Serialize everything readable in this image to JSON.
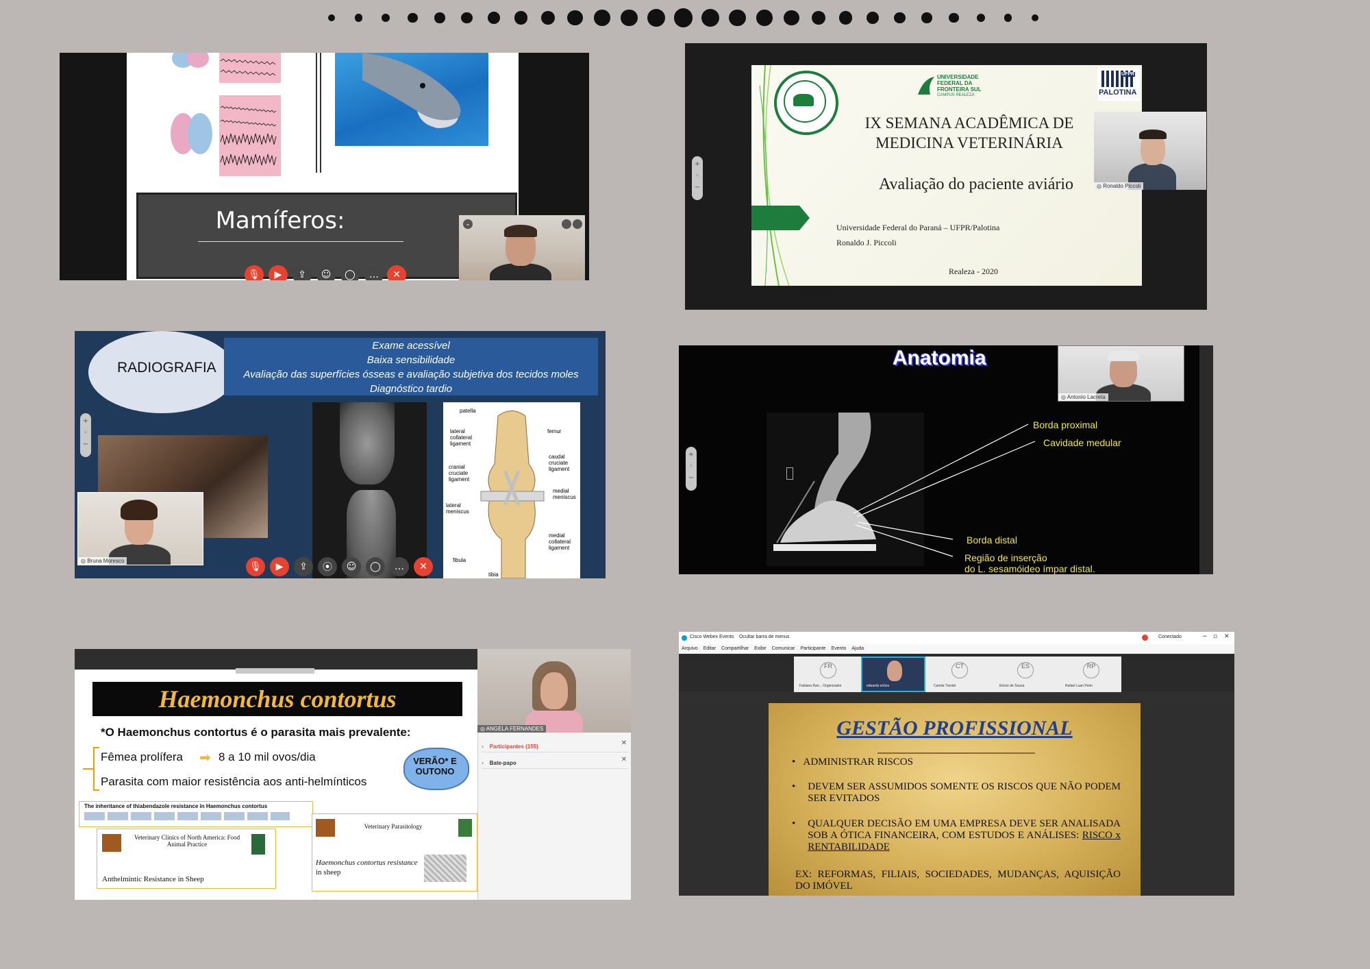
{
  "colors": {
    "background": "#bcb6b5",
    "webex_red": "#e5432f",
    "ufps_green": "#1e7d3c",
    "radio_blue": "#203a5c",
    "radio_band": "#2a5a9a",
    "haemonchus_title": "#f3b73a",
    "bubble_blue": "#7fb2e8",
    "gestao_gold": "#c9a24a",
    "gestao_title": "#1f3f8f",
    "xray_label": "#f0e84a"
  },
  "panel1": {
    "title": "Mamíferos:",
    "controls": [
      "mic-icon",
      "camera-icon",
      "share-icon",
      "participants-icon",
      "chat-icon",
      "more-icon",
      "end-call-icon"
    ]
  },
  "panel2": {
    "univ_lines": [
      "UNIVERSIDADE",
      "FEDERAL DA",
      "FRONTEIRA SUL",
      "CAMPUS REALEZA"
    ],
    "palotina": "PALOTINA",
    "ufpr": "UFPR",
    "title_line1": "IX SEMANA ACADÊMICA DE",
    "title_line2": "MEDICINA VETERINÁRIA",
    "subtitle": "Avaliação do paciente aviário",
    "institution": "Universidade Federal do Paraná – UFPR/Palotina",
    "author": "Ronaldo J. Piccoli",
    "place_year": "Realeza - 2020",
    "participant_name": "Ronaldo Piccoli"
  },
  "panel3": {
    "title": "RADIOGRAFIA",
    "bullets": [
      "Exame acessível",
      "Baixa sensibilidade",
      "Avaliação das superfícies ósseas e avaliação subjetiva dos tecidos moles",
      "Diagnóstico tardio"
    ],
    "participant_name": "Bruna Moresco",
    "anatomy_labels": {
      "patella": "patella",
      "femur": "femur",
      "lateral_collateral": "lateral\ncollateral\nligament",
      "caudal_cruciate": "caudal\ncruciate\nligament",
      "cranial_cruciate": "cranial\ncruciate\nligament",
      "medial_meniscus": "medial\nmeniscus",
      "lateral_meniscus": "lateral\nmeniscus",
      "medial_collateral": "medial\ncollateral\nligament",
      "fibula": "fibula",
      "tibia": "tibia"
    }
  },
  "panel4": {
    "title": "Anatomia",
    "labels": [
      "Borda proximal",
      "Cavidade medular",
      "Borda distal",
      "Região de inserção",
      "do L. sesamóideo ímpar distal."
    ],
    "participant_name": "Antonio Lacreta"
  },
  "panel5": {
    "title": "Haemonchus contortus",
    "lead": "*O Haemonchus contortus é o parasita mais prevalente:",
    "bullet1_a": "Fêmea prolífera",
    "bullet1_b": "8 a 10 mil ovos/dia",
    "bullet2": "Parasita com maior resistência aos anti-helmínticos",
    "bubble": "VERÃO* E\nOUTONO",
    "paper1_title": "The inheritance of thiabendazole resistance in Haemonchus contortus",
    "paper2_journal": "Veterinary Clinics of North America: Food Animal Practice",
    "paper2_title": "Anthelmintic Resistance in Sheep",
    "paper3_journal": "Veterinary Parasitology",
    "paper3_title": "Haemonchus contortus resistance",
    "paper3_title2": "in sheep",
    "participant_name": "ANGELA FERNANDES",
    "participants_label": "Participantes (155)",
    "chat_label": "Bate-papo"
  },
  "panel6": {
    "window_title": "Cisco Webex Events",
    "hide_menu": "Ocultar barra de menus",
    "status": "Conectado",
    "menu": [
      "Arquivo",
      "Editar",
      "Compartilhar",
      "Exibir",
      "Comunicar",
      "Participante",
      "Evento",
      "Ajuda"
    ],
    "participants": [
      {
        "initials": "FR",
        "name": "Fabiana Ran... Organizador"
      },
      {
        "initials": "",
        "name": "eduardo echos"
      },
      {
        "initials": "CT",
        "name": "Camila Trentel"
      },
      {
        "initials": "ES",
        "name": "Eloíze de Souza"
      },
      {
        "initials": "RP",
        "name": "Rafael Luan Perin"
      }
    ],
    "slide_title": "GESTÃO PROFISSIONAL",
    "bullets": [
      "ADMINISTRAR RISCOS",
      "DEVEM SER ASSUMIDOS SOMENTE OS RISCOS QUE NÃO PODEM SER EVITADOS",
      "QUALQUER DECISÃO EM UMA EMPRESA DEVE SER ANALISADA SOB A ÓTICA FINANCEIRA, COM ESTUDOS E ANÁLISES:"
    ],
    "underlined": "RISCO x RENTABILIDADE",
    "example": "EX: REFORMAS, FILIAIS, SOCIEDADES, MUDANÇAS, AQUISIÇÃO DO IMÓVEL"
  }
}
